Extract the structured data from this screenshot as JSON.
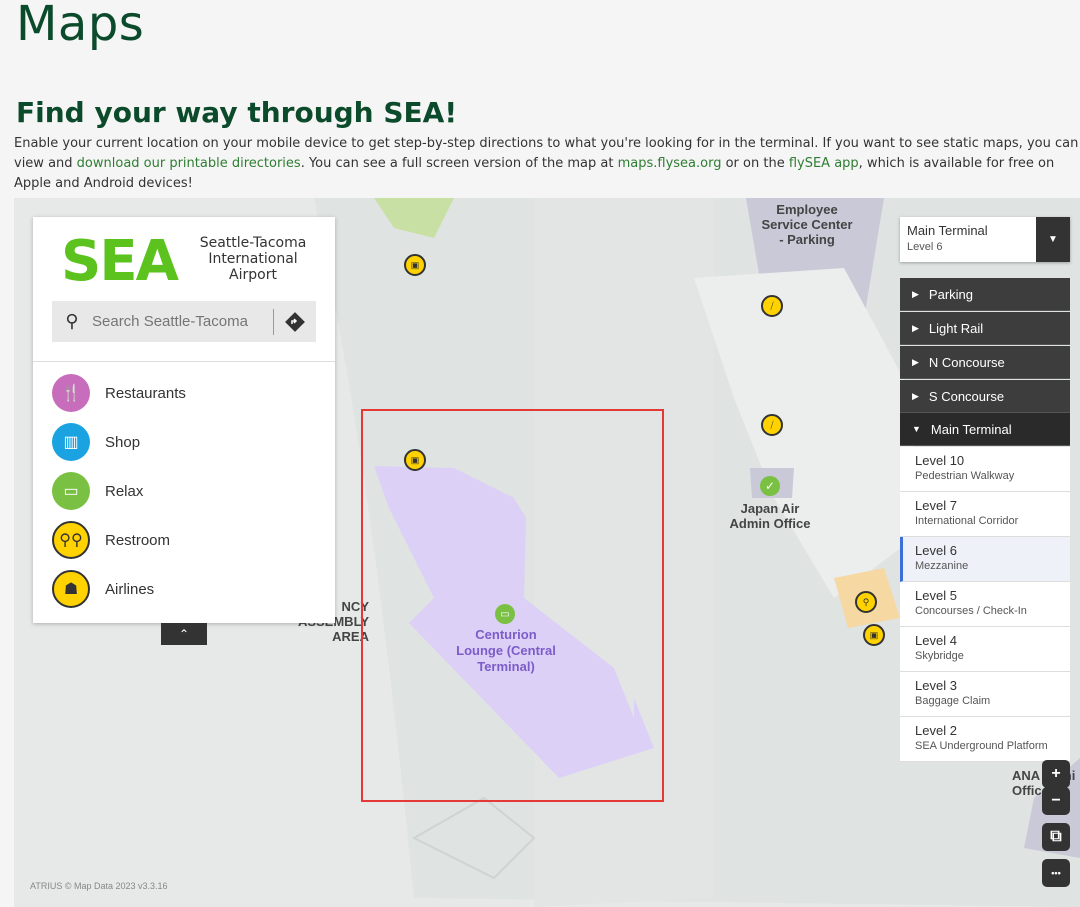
{
  "page": {
    "title": "Maps",
    "subtitle": "Find your way through SEA!",
    "intro_1": "Enable your current location on your mobile device to get step-by-step directions to what you're looking for in the terminal. If you want to see static maps, you can view and ",
    "intro_link_1": "download our printable directories",
    "intro_2": ". You can see a full screen version of the map at ",
    "intro_link_2": "maps.flysea.org",
    "intro_3": " or on the ",
    "intro_link_3": "flySEA app",
    "intro_4": ", which is available for free on Apple and Android devices!"
  },
  "panel": {
    "logo_sea": "SEA",
    "logo_line1": "Seattle-Tacoma",
    "logo_line2": "International",
    "logo_line3": "Airport",
    "search_placeholder": "Search Seattle-Tacoma",
    "categories": [
      {
        "label": "Restaurants",
        "icon": "restaurant-icon",
        "color": "#c86dbb"
      },
      {
        "label": "Shop",
        "icon": "shop-icon",
        "color": "#1aa3e0"
      },
      {
        "label": "Relax",
        "icon": "relax-icon",
        "color": "#7ac143"
      },
      {
        "label": "Restroom",
        "icon": "restroom-icon",
        "color": "#ffd200"
      },
      {
        "label": "Airlines",
        "icon": "airlines-icon",
        "color": "#ffd200"
      }
    ]
  },
  "map": {
    "labels": {
      "employee": "Employee\nService Center\n- Parking",
      "japan_air": "Japan Air\nAdmin Office",
      "emergency": "NCY\nASSEMBLY AREA",
      "lounge": "Centurion\nLounge (Central\nTerminal)",
      "ana": "ANA Admi\nOffice"
    },
    "attribution": "ATRIUS © Map Data 2023  v3.3.16"
  },
  "level_selector": {
    "building": "Main Terminal",
    "level": "Level 6",
    "buildings": [
      "Parking",
      "Light Rail",
      "N Concourse",
      "S Concourse",
      "Main Terminal"
    ],
    "levels": [
      {
        "name": "Level 10",
        "desc": "Pedestrian Walkway"
      },
      {
        "name": "Level 7",
        "desc": "International Corridor"
      },
      {
        "name": "Level 6",
        "desc": "Mezzanine"
      },
      {
        "name": "Level 5",
        "desc": "Concourses / Check-In"
      },
      {
        "name": "Level 4",
        "desc": "Skybridge"
      },
      {
        "name": "Level 3",
        "desc": "Baggage Claim"
      },
      {
        "name": "Level 2",
        "desc": "SEA Underground Platform"
      }
    ]
  },
  "controls": {
    "zoom_in": "+",
    "zoom_out": "−",
    "more": "•••"
  },
  "colors": {
    "brand_green": "#0b4a2a",
    "link": "#2e7d32",
    "lounge": "#ddd0f7",
    "highlight": "#e53935"
  }
}
